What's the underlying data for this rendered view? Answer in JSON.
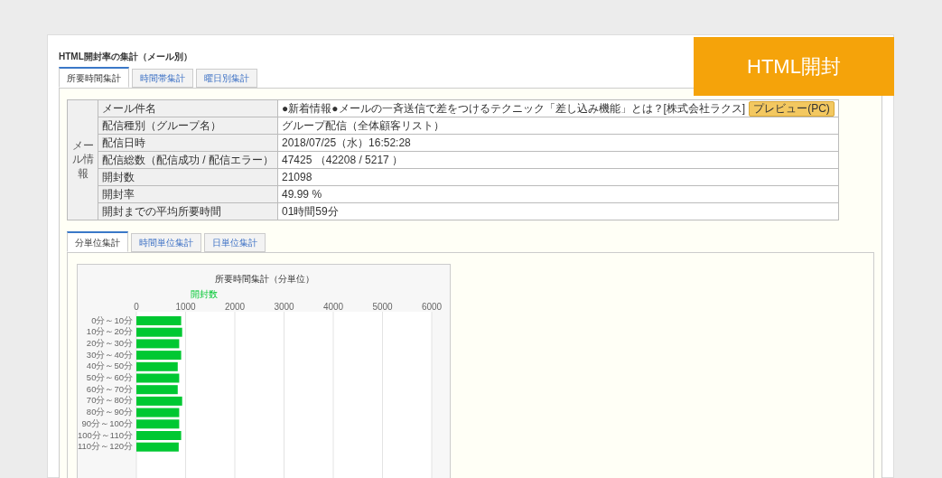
{
  "badge": "HTML開封",
  "heading": "HTML開封率の集計（メール別）",
  "tabs": [
    {
      "label": "所要時間集計",
      "selected": true
    },
    {
      "label": "時間帯集計",
      "selected": false
    },
    {
      "label": "曜日別集計",
      "selected": false
    }
  ],
  "info_table": {
    "group_label": "メール情報",
    "rows": [
      {
        "label": "メール件名",
        "value": "●新着情報●メールの一斉送信で差をつけるテクニック「差し込み機能」とは？[株式会社ラクス]",
        "button": "プレビュー(PC)"
      },
      {
        "label": "配信種別（グループ名）",
        "value": "グループ配信（全体顧客リスト）"
      },
      {
        "label": "配信日時",
        "value": "2018/07/25（水）16:52:28"
      },
      {
        "label": "配信総数（配信成功 / 配信エラー）",
        "value": "47425 （42208 / 5217 ）"
      },
      {
        "label": "開封数",
        "value": "21098"
      },
      {
        "label": "開封率",
        "value": "49.99 %"
      },
      {
        "label": "開封までの平均所要時間",
        "value": "01時間59分"
      }
    ]
  },
  "sub_tabs": [
    {
      "label": "分単位集計",
      "selected": true
    },
    {
      "label": "時間単位集計",
      "selected": false
    },
    {
      "label": "日単位集計",
      "selected": false
    }
  ],
  "chart_data": {
    "type": "bar",
    "orientation": "horizontal",
    "title": "所要時間集計（分単位）",
    "categories": [
      "0分～10分",
      "10分～20分",
      "20分～30分",
      "30分～40分",
      "40分～50分",
      "50分～60分",
      "60分～70分",
      "70分～80分",
      "80分～90分",
      "90分～100分",
      "100分～110分",
      "110分～120分"
    ],
    "series": [
      {
        "name": "開封数",
        "color": "#00c832",
        "values": [
          910,
          930,
          870,
          910,
          840,
          870,
          840,
          930,
          870,
          870,
          910,
          860
        ]
      }
    ],
    "grid": true,
    "xlim": [
      0,
      6000
    ],
    "xticks": [
      0,
      1000,
      2000,
      3000,
      4000,
      5000,
      6000
    ]
  }
}
